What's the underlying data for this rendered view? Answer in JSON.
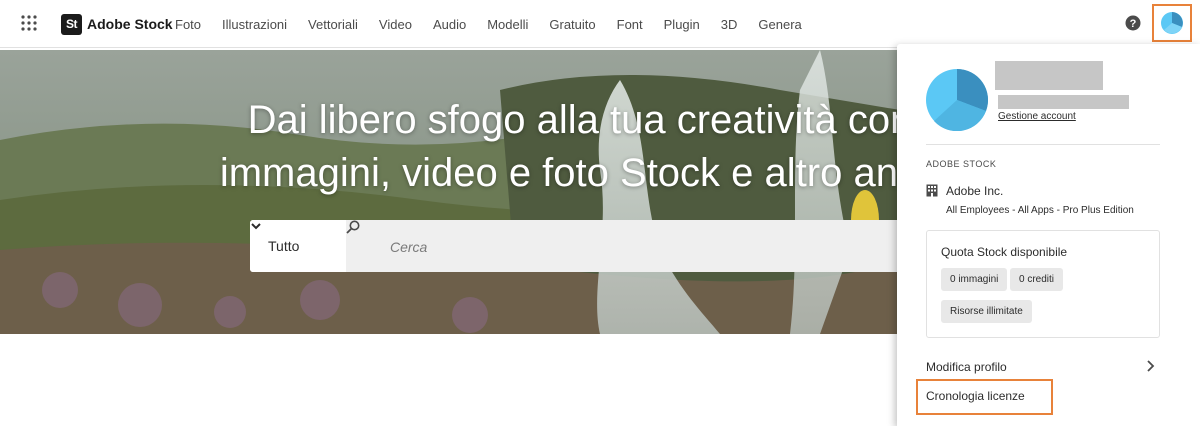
{
  "nav": {
    "brand_logo": "St",
    "brand_name": "Adobe Stock",
    "items": [
      "Foto",
      "Illustrazioni",
      "Vettoriali",
      "Video",
      "Audio",
      "Modelli",
      "Gratuito",
      "Font",
      "Plugin",
      "3D",
      "Genera"
    ]
  },
  "hero": {
    "headline_line1": "Dai libero sfogo alla tua creatività con",
    "headline_line2": "immagini, video e foto Stock e altro anco"
  },
  "search": {
    "category": "Tutto",
    "placeholder": "Cerca"
  },
  "account": {
    "manage_link": "Gestione account",
    "section_label": "ADOBE STOCK",
    "org_name": "Adobe Inc.",
    "org_plan": "All Employees - All Apps - Pro Plus Edition",
    "quota": {
      "title": "Quota Stock disponibile",
      "images": "0 immagini",
      "credits": "0 crediti",
      "unlimited": "Risorse illimitate"
    },
    "menu": {
      "edit_profile": "Modifica profilo",
      "license_history": "Cronologia licenze"
    }
  },
  "colors": {
    "accent_highlight": "#e8823a",
    "avatar_light": "#5bc8f5",
    "avatar_dark": "#3a8fbf"
  }
}
